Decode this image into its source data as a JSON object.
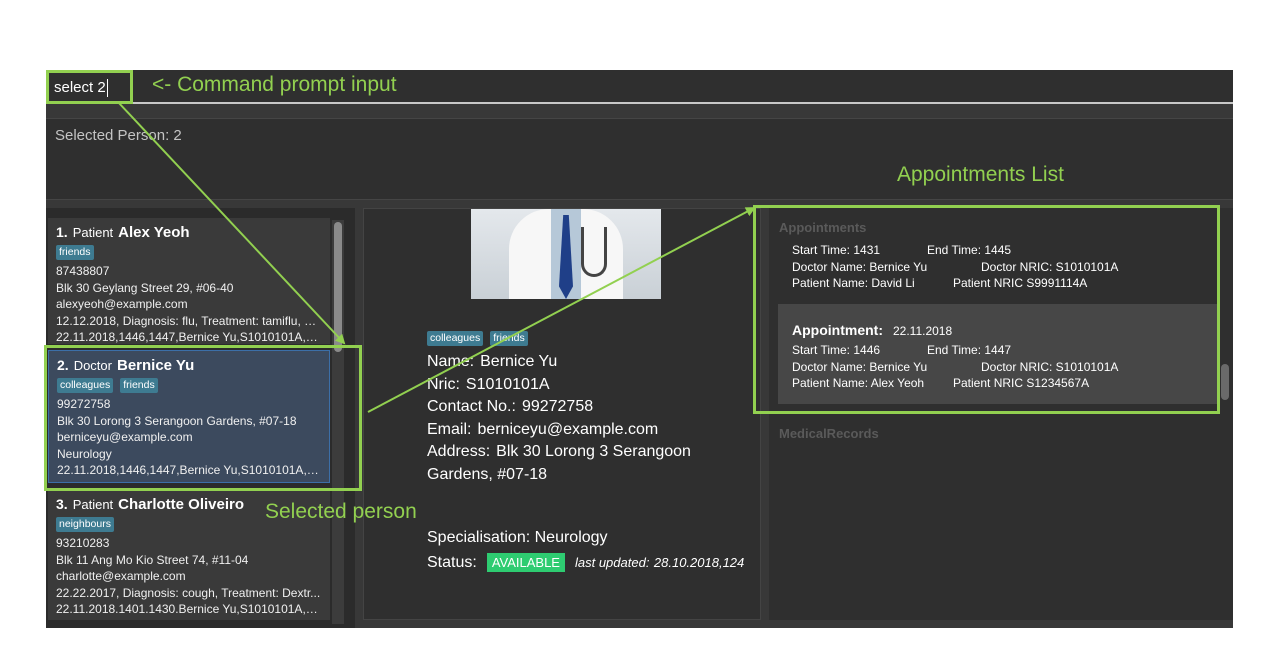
{
  "command": {
    "value": "select 2"
  },
  "result": {
    "text": "Selected Person: 2"
  },
  "persons": [
    {
      "index": "1.",
      "role": "Patient",
      "name": "Alex Yeoh",
      "tags": [
        "friends"
      ],
      "lines": [
        "87438807",
        "Blk 30 Geylang Street 29, #06-40",
        "alexyeoh@example.com",
        "12.12.2018, Diagnosis: flu, Treatment: tamiflu, C...",
        "22.11.2018,1446,1447,Bernice Yu,S1010101A,Al..."
      ]
    },
    {
      "index": "2.",
      "role": "Doctor",
      "name": "Bernice Yu",
      "tags": [
        "colleagues",
        "friends"
      ],
      "lines": [
        "99272758",
        "Blk 30 Lorong 3 Serangoon Gardens, #07-18",
        "berniceyu@example.com",
        "Neurology",
        "22.11.2018,1446,1447,Bernice Yu,S1010101A,Al..."
      ]
    },
    {
      "index": "3.",
      "role": "Patient",
      "name": "Charlotte Oliveiro",
      "tags": [
        "neighbours"
      ],
      "lines": [
        "93210283",
        "Blk 11 Ang Mo Kio Street 74, #11-04",
        "charlotte@example.com",
        "22.22.2017, Diagnosis: cough, Treatment: Dextr...",
        "22.11.2018.1401.1430.Bernice Yu,S1010101A,Ch..."
      ]
    }
  ],
  "detail": {
    "tags": [
      "colleagues",
      "friends"
    ],
    "name_label": "Name:",
    "name": "Bernice Yu",
    "nric_label": "Nric:",
    "nric": "S1010101A",
    "contact_label": "Contact No.:",
    "contact": "99272758",
    "email_label": "Email:",
    "email": "berniceyu@example.com",
    "address_label": "Address:",
    "address": "Blk 30 Lorong 3 Serangoon Gardens, #07-18",
    "spec_label": "Specialisation:",
    "specialisation": "Neurology",
    "status_label": "Status:",
    "status": "AVAILABLE",
    "last_updated_label": "last updated:",
    "last_updated": "28.10.2018,124"
  },
  "appointments": {
    "title": "Appointments",
    "records_title": "MedicalRecords",
    "items": [
      {
        "start_label": "Start Time: 1431",
        "end_label": "End Time: 1445",
        "doctor_name": "Doctor Name: Bernice Yu",
        "doctor_nric": "Doctor NRIC: S1010101A",
        "patient_name": "Patient Name: David Li",
        "patient_nric": "Patient NRIC S9991114A"
      },
      {
        "heading": "Appointment:",
        "date": "22.11.2018",
        "start_label": "Start Time: 1446",
        "end_label": "End Time: 1447",
        "doctor_name": "Doctor Name: Bernice Yu",
        "doctor_nric": "Doctor NRIC: S1010101A",
        "patient_name": "Patient Name: Alex Yeoh",
        "patient_nric": "Patient NRIC S1234567A"
      }
    ]
  },
  "annotations": {
    "command_prompt": "<- Command prompt input",
    "appointments_list": "Appointments List",
    "selected_person": "Selected person"
  },
  "colors": {
    "annotation": "#92d050",
    "status": "#2ecc71",
    "tag": "#3e7b91"
  }
}
